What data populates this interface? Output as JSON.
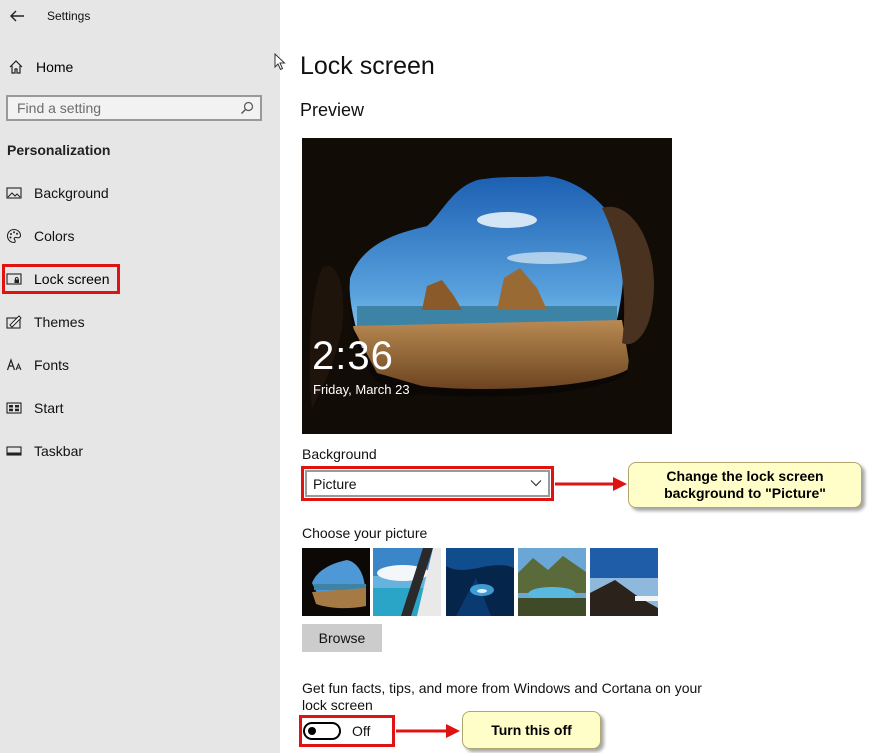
{
  "app": {
    "title": "Settings"
  },
  "sidebar": {
    "home_label": "Home",
    "search_placeholder": "Find a setting",
    "section": "Personalization",
    "items": [
      {
        "label": "Background",
        "icon": "picture-icon"
      },
      {
        "label": "Colors",
        "icon": "palette-icon"
      },
      {
        "label": "Lock screen",
        "icon": "lock-screen-icon",
        "selected": true
      },
      {
        "label": "Themes",
        "icon": "themes-icon"
      },
      {
        "label": "Fonts",
        "icon": "fonts-icon"
      },
      {
        "label": "Start",
        "icon": "start-icon"
      },
      {
        "label": "Taskbar",
        "icon": "taskbar-icon"
      }
    ]
  },
  "main": {
    "title": "Lock screen",
    "preview_heading": "Preview",
    "preview": {
      "time": "2:36",
      "date": "Friday, March 23"
    },
    "background_label": "Background",
    "background_value": "Picture",
    "choose_picture_label": "Choose your picture",
    "browse_label": "Browse",
    "fun_facts_text": "Get fun facts, tips, and more from Windows and Cortana on your lock screen",
    "fun_facts_toggle": "Off"
  },
  "annotations": {
    "callout_background": "Change the lock screen background to \"Picture\"",
    "callout_toggle": "Turn this off",
    "highlight_color": "#e01313"
  }
}
